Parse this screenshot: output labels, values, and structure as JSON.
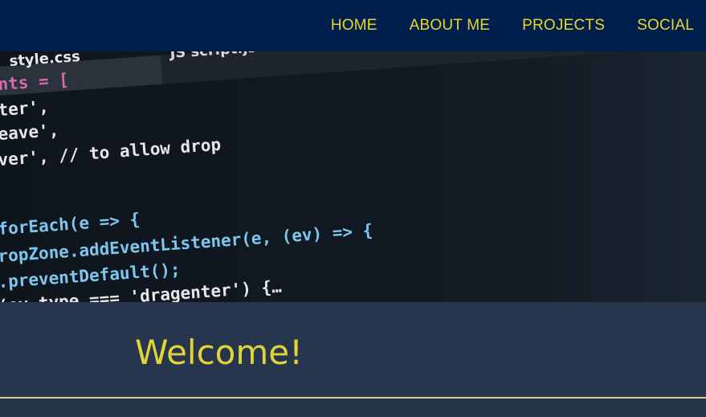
{
  "nav": {
    "items": [
      "HOME",
      "ABOUT ME",
      "PROJECTS",
      "SOCIAL"
    ]
  },
  "hero": {
    "tab_1": "style.css",
    "tab_2": "JS script.js",
    "code_lines": [
      "nts = [",
      "ter',",
      "eave',",
      "ver', // to allow drop",
      "forEach(e => {",
      "ropZone.addEventListener(e, (ev) => {",
      ".preventDefault();",
      "(ev.type === 'dragenter') {…"
    ]
  },
  "welcome": {
    "heading": "Welcome!"
  },
  "colors": {
    "nav_bg": "#001f4d",
    "accent": "#e1d535",
    "section_bg": "#27364e"
  }
}
